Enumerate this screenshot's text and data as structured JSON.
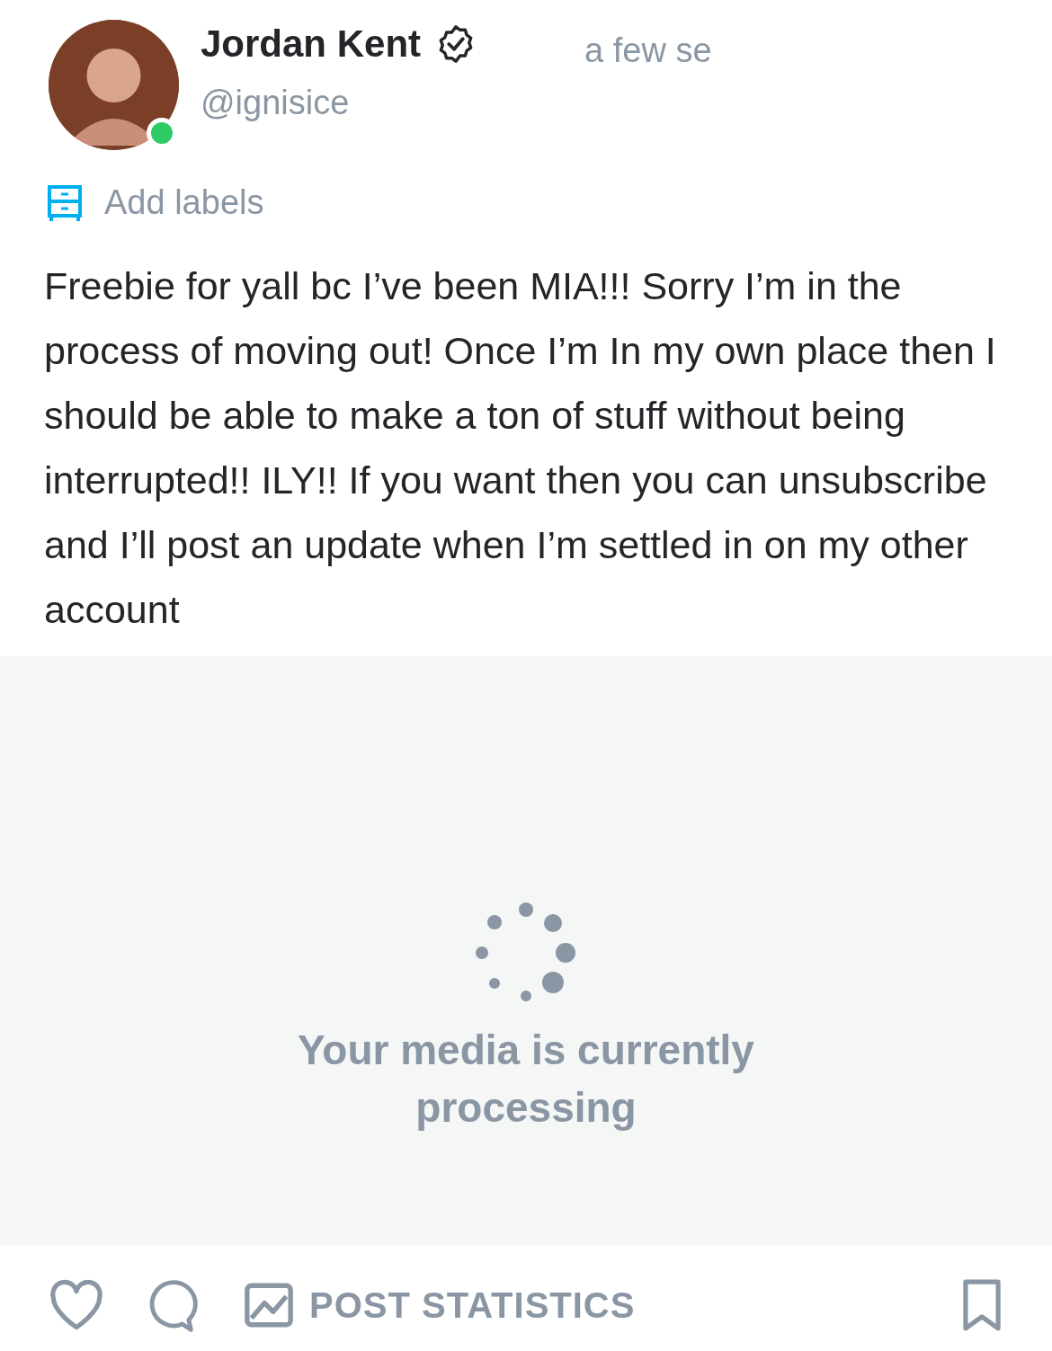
{
  "post": {
    "author": {
      "name": "Jordan Kent",
      "verified": true,
      "online": true,
      "handle": "@ignisice"
    },
    "time": "a few se",
    "labels_link": "Add labels",
    "text": "Freebie for yall bc I’ve been MIA!!! Sorry I’m in the process of moving out! Once I’m In my own place then I should be able to make a ton of stuff without being interrupted!! ILY!! If you want then you can unsubscribe and I’ll post an update when I’m settled in on my other account",
    "media": {
      "status": "Your media is currently processing"
    }
  },
  "actions": {
    "post_statistics": "POST STATISTICS"
  }
}
